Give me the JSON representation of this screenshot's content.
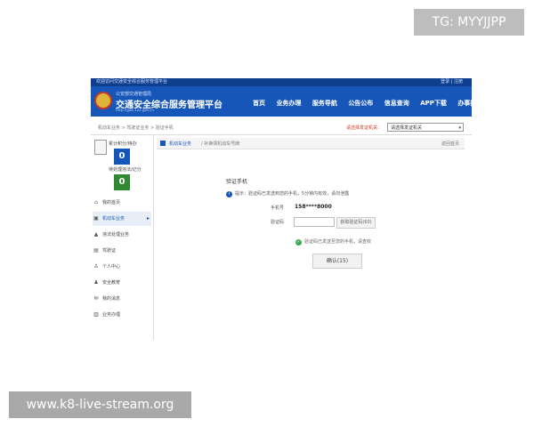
{
  "overlay": {
    "tag": "TG: MYYJJPP",
    "watermark": "www.k8-live-stream.org"
  },
  "topbar": {
    "left": "欢迎访问交通安全综合服务管理平台",
    "right": "登录 | 注册"
  },
  "header": {
    "subtitle": "公安部交通管理局",
    "title": "交通安全综合服务管理平台",
    "url": "http://gab.122.gov.cn",
    "nav": [
      "首页",
      "业务办理",
      "服务导航",
      "公告公布",
      "信息查询",
      "APP下载",
      "办事指南"
    ]
  },
  "crumbbar": {
    "crumb": "机动车业务 > 驾驶证业务 > 验证手机",
    "select_label": "请选择发证机关：",
    "select_value": "请选择发证机关"
  },
  "sidebar": {
    "stats": [
      {
        "label": "累计积分/待办",
        "value": "0",
        "color": "#1656b8"
      },
      {
        "label": "待处理违法/记分",
        "value": "0",
        "color": "#2f8a33"
      }
    ],
    "menu": [
      {
        "icon": "home-icon",
        "glyph": "⌂",
        "label": "我的首页"
      },
      {
        "icon": "car-icon",
        "glyph": "▣",
        "label": "机动车业务",
        "active": true
      },
      {
        "icon": "warning-icon",
        "glyph": "▲",
        "label": "违法处理业务"
      },
      {
        "icon": "chart-icon",
        "glyph": "▤",
        "label": "驾驶证"
      },
      {
        "icon": "person-icon",
        "glyph": "♙",
        "label": "个人中心"
      },
      {
        "icon": "users-icon",
        "glyph": "♟",
        "label": "安全教育"
      },
      {
        "icon": "mail-icon",
        "glyph": "✉",
        "label": "我的消息"
      },
      {
        "icon": "book-icon",
        "glyph": "▥",
        "label": "业务办理"
      }
    ]
  },
  "main": {
    "tab": "机动车业务",
    "path": "/ 补换领机动车号牌",
    "back": "返回首页",
    "section_title": "验证手机",
    "notice": "提示：验证码已发送到您的手机，5分钟内有效，请勿泄露",
    "phone_label": "手机号",
    "phone_value": "158****8000",
    "code_label": "验证码",
    "get_code": "获取验证码(60)",
    "tip": "验证码已发送至您的手机，请查收",
    "confirm": "确认(15)"
  }
}
